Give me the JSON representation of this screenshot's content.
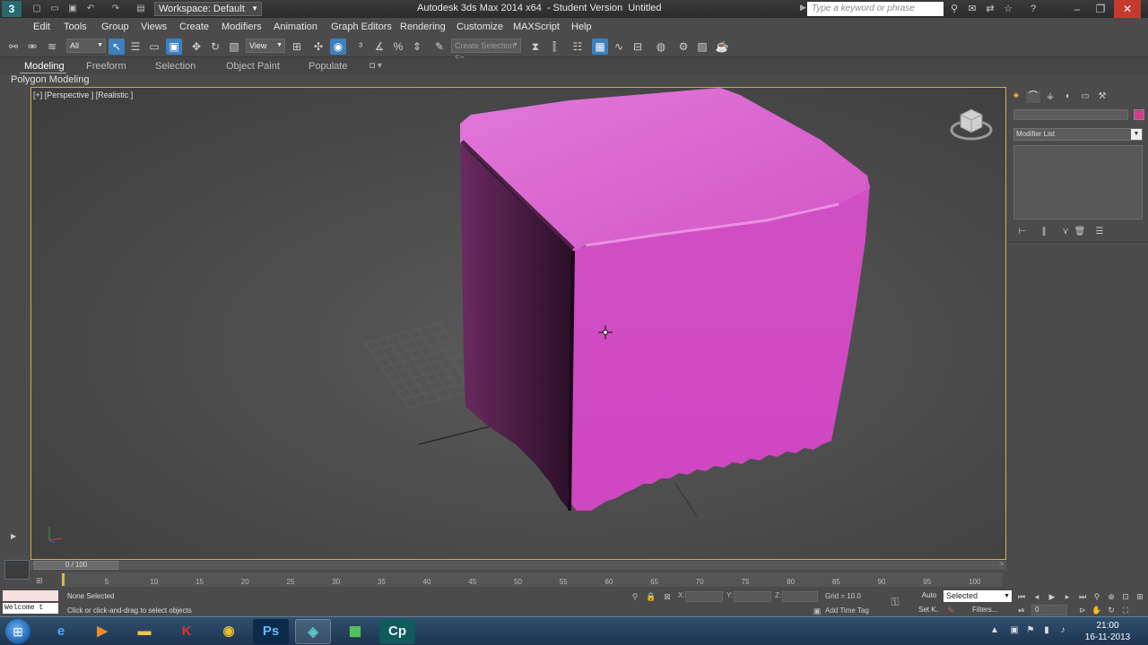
{
  "titlebar": {
    "workspace": "Workspace: Default",
    "app_title": "Autodesk 3ds Max  2014 x64",
    "edition": "- Student Version",
    "doc_name": "Untitled",
    "search_placeholder": "Type a keyword or phrase"
  },
  "menu": [
    "Edit",
    "Tools",
    "Group",
    "Views",
    "Create",
    "Modifiers",
    "Animation",
    "Graph Editors",
    "Rendering",
    "Customize",
    "MAXScript",
    "Help"
  ],
  "toolbar": {
    "selection_filter": "All",
    "ref_coord": "View",
    "named_selection_placeholder": "Create Selection Se"
  },
  "ribbon": {
    "tabs": [
      "Modeling",
      "Freeform",
      "Selection",
      "Object Paint",
      "Populate"
    ],
    "active_tab": "Modeling",
    "panel_label": "Polygon Modeling"
  },
  "viewport": {
    "label": "[+] [Perspective ] [Realistic ]",
    "object_color": "#d94fc8",
    "border_color": "#d8a84a"
  },
  "command_panel": {
    "modifier_list": "Modifier List",
    "object_color": "#d63a8a"
  },
  "timeline": {
    "frame_display": "0 / 100",
    "ticks": [
      "5",
      "10",
      "15",
      "20",
      "25",
      "30",
      "35",
      "40",
      "45",
      "50",
      "55",
      "60",
      "65",
      "70",
      "75",
      "80",
      "85",
      "90",
      "95",
      "100"
    ]
  },
  "statusbar": {
    "welcome": "Welcome t",
    "selection_status": "None Selected",
    "prompt": "Click or click-and-drag to select objects",
    "x_label": "X:",
    "y_label": "Y:",
    "z_label": "Z:",
    "grid": "Grid = 10.0",
    "add_time_tag": "Add Time Tag",
    "auto_key": "Auto",
    "key_filter": "Selected",
    "set_key": "Set K.",
    "filters": "Filters...",
    "current_frame": "0"
  },
  "taskbar": {
    "time": "21:00",
    "date": "16-11-2013",
    "apps": [
      "ie-icon",
      "media-player-icon",
      "explorer-icon",
      "kaspersky-icon",
      "chrome-icon",
      "photoshop-icon",
      "3dsmax-icon",
      "mail-icon",
      "captivate-icon"
    ],
    "labels": {
      "photoshop": "Ps",
      "captivate": "Cp"
    }
  }
}
